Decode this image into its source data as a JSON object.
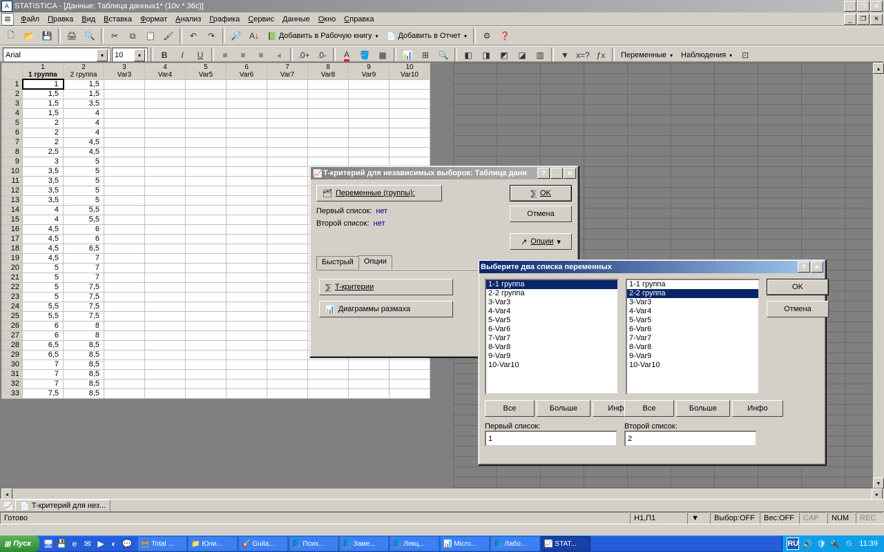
{
  "app": {
    "title": "STATISTICA - [Данные: Таблица данных1* (10v * 36c)]"
  },
  "menu": [
    "Файл",
    "Правка",
    "Вид",
    "Вставка",
    "Формат",
    "Анализ",
    "Графика",
    "Сервис",
    "Данные",
    "Окно",
    "Справка"
  ],
  "toolbar1": {
    "addWorkbook": "Добавить в Рабочую книгу",
    "addReport": "Добавить в Отчет"
  },
  "toolbar2": {
    "font": "Arial",
    "size": "10",
    "vars": "Переменные",
    "obs": "Наблюдения"
  },
  "columns": [
    {
      "num": "1",
      "name": "1 группа",
      "bold": true
    },
    {
      "num": "2",
      "name": "2 группа"
    },
    {
      "num": "3",
      "name": "Var3"
    },
    {
      "num": "4",
      "name": "Var4"
    },
    {
      "num": "5",
      "name": "Var5"
    },
    {
      "num": "6",
      "name": "Var6"
    },
    {
      "num": "7",
      "name": "Var7"
    },
    {
      "num": "8",
      "name": "Var8"
    },
    {
      "num": "9",
      "name": "Var9"
    },
    {
      "num": "10",
      "name": "Var10"
    }
  ],
  "rows": [
    {
      "r": "1",
      "c1": "1",
      "c2": "1,5"
    },
    {
      "r": "2",
      "c1": "1,5",
      "c2": "1,5"
    },
    {
      "r": "3",
      "c1": "1,5",
      "c2": "3,5"
    },
    {
      "r": "4",
      "c1": "1,5",
      "c2": "4"
    },
    {
      "r": "5",
      "c1": "2",
      "c2": "4"
    },
    {
      "r": "6",
      "c1": "2",
      "c2": "4"
    },
    {
      "r": "7",
      "c1": "2",
      "c2": "4,5"
    },
    {
      "r": "8",
      "c1": "2,5",
      "c2": "4,5"
    },
    {
      "r": "9",
      "c1": "3",
      "c2": "5"
    },
    {
      "r": "10",
      "c1": "3,5",
      "c2": "5"
    },
    {
      "r": "11",
      "c1": "3,5",
      "c2": "5"
    },
    {
      "r": "12",
      "c1": "3,5",
      "c2": "5"
    },
    {
      "r": "13",
      "c1": "3,5",
      "c2": "5"
    },
    {
      "r": "14",
      "c1": "4",
      "c2": "5,5"
    },
    {
      "r": "15",
      "c1": "4",
      "c2": "5,5"
    },
    {
      "r": "16",
      "c1": "4,5",
      "c2": "6"
    },
    {
      "r": "17",
      "c1": "4,5",
      "c2": "6"
    },
    {
      "r": "18",
      "c1": "4,5",
      "c2": "6,5"
    },
    {
      "r": "19",
      "c1": "4,5",
      "c2": "7"
    },
    {
      "r": "20",
      "c1": "5",
      "c2": "7"
    },
    {
      "r": "21",
      "c1": "5",
      "c2": "7"
    },
    {
      "r": "22",
      "c1": "5",
      "c2": "7,5"
    },
    {
      "r": "23",
      "c1": "5",
      "c2": "7,5"
    },
    {
      "r": "24",
      "c1": "5,5",
      "c2": "7,5"
    },
    {
      "r": "25",
      "c1": "5,5",
      "c2": "7,5"
    },
    {
      "r": "26",
      "c1": "6",
      "c2": "8"
    },
    {
      "r": "27",
      "c1": "6",
      "c2": "8"
    },
    {
      "r": "28",
      "c1": "6,5",
      "c2": "8,5"
    },
    {
      "r": "29",
      "c1": "6,5",
      "c2": "8,5"
    },
    {
      "r": "30",
      "c1": "7",
      "c2": "8,5"
    },
    {
      "r": "31",
      "c1": "7",
      "c2": "8,5"
    },
    {
      "r": "32",
      "c1": "7",
      "c2": "8,5"
    },
    {
      "r": "33",
      "c1": "7,5",
      "c2": "8,5"
    }
  ],
  "docbar": {
    "tab": "T-критерий для нез..."
  },
  "status": {
    "ready": "Готово",
    "pos": "Н1,П1",
    "sel": "Выбор:OFF",
    "weight": "Вес:OFF",
    "cap": "CAP",
    "num": "NUM",
    "rec": "REC"
  },
  "dialog1": {
    "title": "T-критерий для независимых выборок: Таблица данн",
    "varsBtn": "Переменные (группы):",
    "firstLbl": "Первый список:",
    "firstVal": "нет",
    "secondLbl": "Второй список:",
    "secondVal": "нет",
    "ok": "OK",
    "cancel": "Отмена",
    "options": "Опции",
    "tab1": "Быстрый",
    "tab2": "Опции",
    "tcrit": "T-критерии",
    "boxplot": "Диаграммы размаха"
  },
  "dialog2": {
    "title": "Выберите два списка переменных",
    "ok": "OK",
    "cancel": "Отмена",
    "items": [
      "1-1 группа",
      "2-2 группа",
      "3-Var3",
      "4-Var4",
      "5-Var5",
      "6-Var6",
      "7-Var7",
      "8-Var8",
      "9-Var9",
      "10-Var10"
    ],
    "sel1": 0,
    "sel2": 1,
    "all": "Все",
    "more": "Больше",
    "info": "Инфо",
    "firstLbl": "Первый список:",
    "secondLbl": "Второй список:",
    "firstVal": "1",
    "secondVal": "2"
  },
  "taskbar": {
    "start": "Пуск",
    "buttons": [
      {
        "icon": "🧮",
        "label": "Total ..."
      },
      {
        "icon": "📁",
        "label": "Юли..."
      },
      {
        "icon": "🎸",
        "label": "Guita..."
      },
      {
        "icon": "📘",
        "label": "Псих..."
      },
      {
        "icon": "📘",
        "label": "Заме..."
      },
      {
        "icon": "📘",
        "label": "Лекц..."
      },
      {
        "icon": "📊",
        "label": "Micro..."
      },
      {
        "icon": "📘",
        "label": "Лабо..."
      },
      {
        "icon": "📈",
        "label": "STAT...",
        "active": true
      }
    ],
    "lang": "RU",
    "clock": "11:39"
  }
}
